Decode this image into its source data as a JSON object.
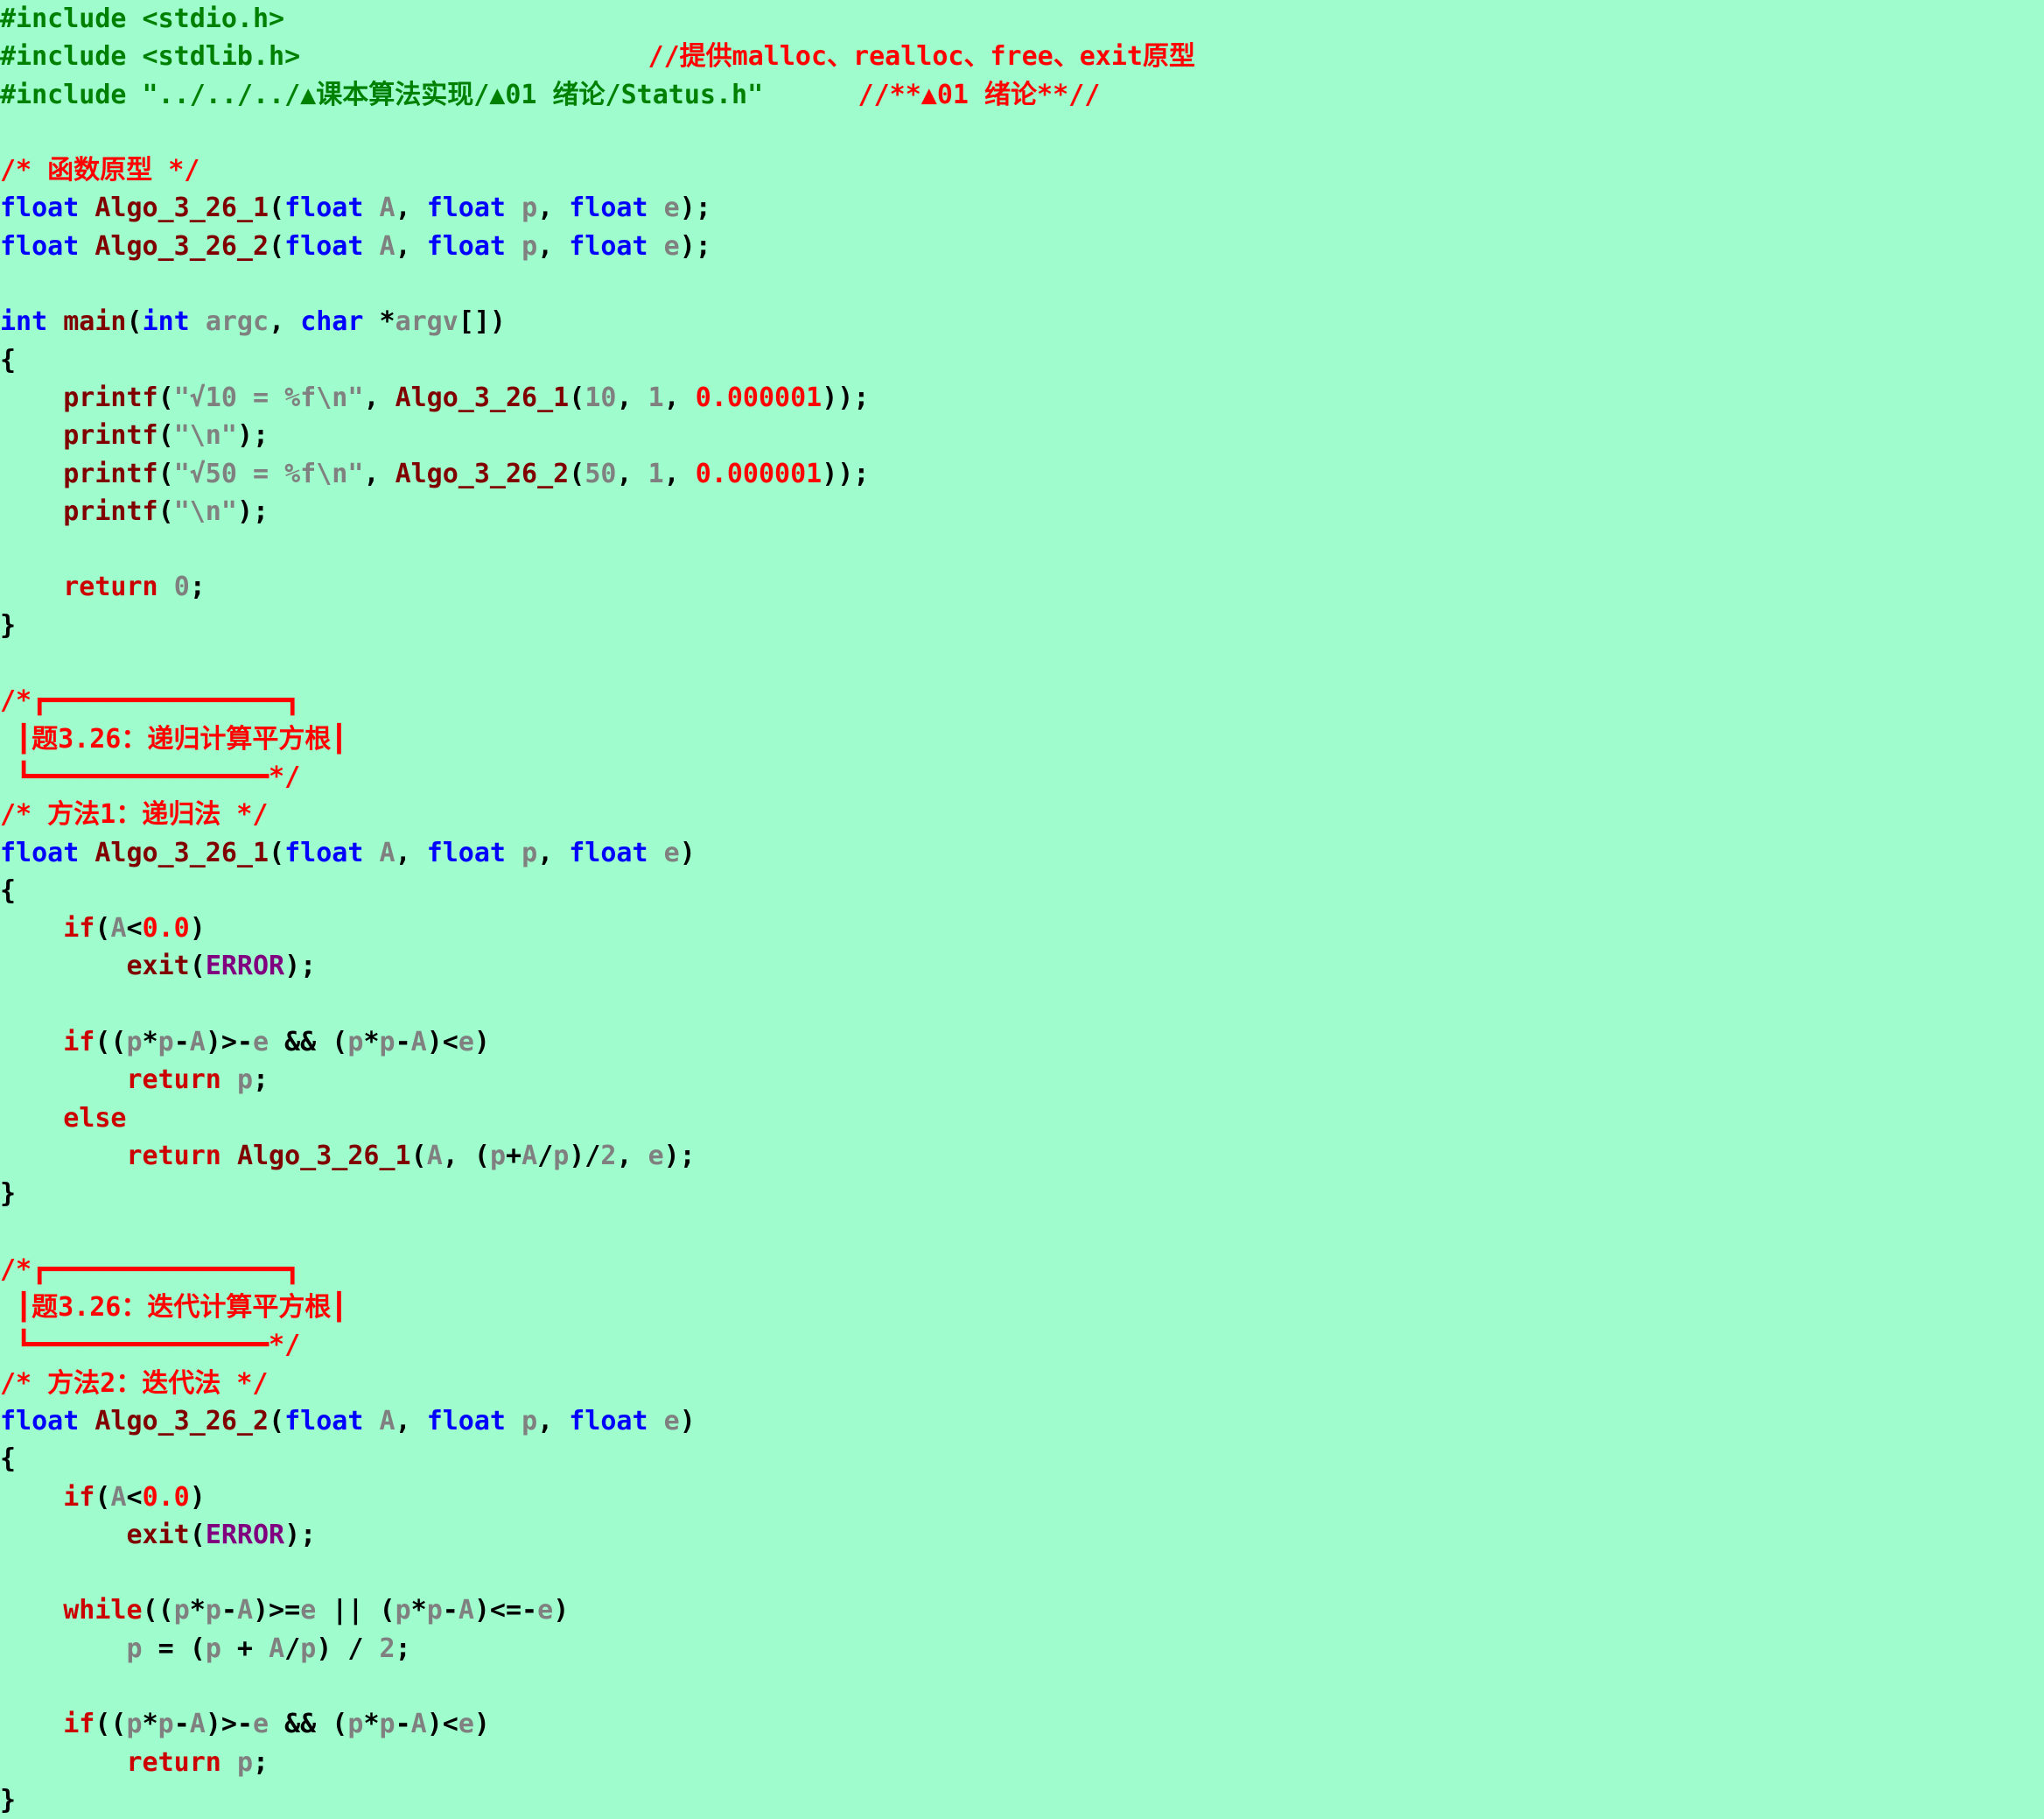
{
  "colors": {
    "background": "#9ffccc",
    "preprocessor": "#008000",
    "comment": "#ff0000",
    "keyword": "#0000ff",
    "control": "#cc0000",
    "function": "#800000",
    "identifier": "#808080",
    "number": "#ff0000",
    "macro": "#800080",
    "operator": "#000000"
  },
  "code_lines": [
    [
      {
        "t": "#include <stdio.h>",
        "c": "preprocessor"
      }
    ],
    [
      {
        "t": "#include <stdlib.h>",
        "c": "preprocessor"
      },
      {
        "t": "                      ",
        "c": "operator"
      },
      {
        "t": "//提供malloc、realloc、free、exit原型",
        "c": "comment"
      }
    ],
    [
      {
        "t": "#include \"../../../▲课本算法实现/▲01 绪论/Status.h\"",
        "c": "preprocessor"
      },
      {
        "t": "      ",
        "c": "operator"
      },
      {
        "t": "//**▲01 绪论**//",
        "c": "comment"
      }
    ],
    [],
    [
      {
        "t": "/* 函数原型 */",
        "c": "comment"
      }
    ],
    [
      {
        "t": "float",
        "c": "keyword"
      },
      {
        "t": " ",
        "c": "operator"
      },
      {
        "t": "Algo_3_26_1",
        "c": "function"
      },
      {
        "t": "(",
        "c": "operator"
      },
      {
        "t": "float",
        "c": "keyword"
      },
      {
        "t": " ",
        "c": "operator"
      },
      {
        "t": "A",
        "c": "identifier"
      },
      {
        "t": ", ",
        "c": "operator"
      },
      {
        "t": "float",
        "c": "keyword"
      },
      {
        "t": " ",
        "c": "operator"
      },
      {
        "t": "p",
        "c": "identifier"
      },
      {
        "t": ", ",
        "c": "operator"
      },
      {
        "t": "float",
        "c": "keyword"
      },
      {
        "t": " ",
        "c": "operator"
      },
      {
        "t": "e",
        "c": "identifier"
      },
      {
        "t": ");",
        "c": "operator"
      }
    ],
    [
      {
        "t": "float",
        "c": "keyword"
      },
      {
        "t": " ",
        "c": "operator"
      },
      {
        "t": "Algo_3_26_2",
        "c": "function"
      },
      {
        "t": "(",
        "c": "operator"
      },
      {
        "t": "float",
        "c": "keyword"
      },
      {
        "t": " ",
        "c": "operator"
      },
      {
        "t": "A",
        "c": "identifier"
      },
      {
        "t": ", ",
        "c": "operator"
      },
      {
        "t": "float",
        "c": "keyword"
      },
      {
        "t": " ",
        "c": "operator"
      },
      {
        "t": "p",
        "c": "identifier"
      },
      {
        "t": ", ",
        "c": "operator"
      },
      {
        "t": "float",
        "c": "keyword"
      },
      {
        "t": " ",
        "c": "operator"
      },
      {
        "t": "e",
        "c": "identifier"
      },
      {
        "t": ");",
        "c": "operator"
      }
    ],
    [],
    [
      {
        "t": "int",
        "c": "keyword"
      },
      {
        "t": " ",
        "c": "operator"
      },
      {
        "t": "main",
        "c": "function"
      },
      {
        "t": "(",
        "c": "operator"
      },
      {
        "t": "int",
        "c": "keyword"
      },
      {
        "t": " ",
        "c": "operator"
      },
      {
        "t": "argc",
        "c": "identifier"
      },
      {
        "t": ", ",
        "c": "operator"
      },
      {
        "t": "char",
        "c": "keyword"
      },
      {
        "t": " *",
        "c": "operator"
      },
      {
        "t": "argv",
        "c": "identifier"
      },
      {
        "t": "[])",
        "c": "operator"
      }
    ],
    [
      {
        "t": "{",
        "c": "operator"
      }
    ],
    [
      {
        "t": "    ",
        "c": "operator"
      },
      {
        "t": "printf",
        "c": "function"
      },
      {
        "t": "(",
        "c": "operator"
      },
      {
        "t": "\"√10 = %f\\n\"",
        "c": "identifier"
      },
      {
        "t": ", ",
        "c": "operator"
      },
      {
        "t": "Algo_3_26_1",
        "c": "function"
      },
      {
        "t": "(",
        "c": "operator"
      },
      {
        "t": "10",
        "c": "identifier"
      },
      {
        "t": ", ",
        "c": "operator"
      },
      {
        "t": "1",
        "c": "identifier"
      },
      {
        "t": ", ",
        "c": "operator"
      },
      {
        "t": "0.000001",
        "c": "number"
      },
      {
        "t": "));",
        "c": "operator"
      }
    ],
    [
      {
        "t": "    ",
        "c": "operator"
      },
      {
        "t": "printf",
        "c": "function"
      },
      {
        "t": "(",
        "c": "operator"
      },
      {
        "t": "\"\\n\"",
        "c": "identifier"
      },
      {
        "t": ");",
        "c": "operator"
      }
    ],
    [
      {
        "t": "    ",
        "c": "operator"
      },
      {
        "t": "printf",
        "c": "function"
      },
      {
        "t": "(",
        "c": "operator"
      },
      {
        "t": "\"√50 = %f\\n\"",
        "c": "identifier"
      },
      {
        "t": ", ",
        "c": "operator"
      },
      {
        "t": "Algo_3_26_2",
        "c": "function"
      },
      {
        "t": "(",
        "c": "operator"
      },
      {
        "t": "50",
        "c": "identifier"
      },
      {
        "t": ", ",
        "c": "operator"
      },
      {
        "t": "1",
        "c": "identifier"
      },
      {
        "t": ", ",
        "c": "operator"
      },
      {
        "t": "0.000001",
        "c": "number"
      },
      {
        "t": "));",
        "c": "operator"
      }
    ],
    [
      {
        "t": "    ",
        "c": "operator"
      },
      {
        "t": "printf",
        "c": "function"
      },
      {
        "t": "(",
        "c": "operator"
      },
      {
        "t": "\"\\n\"",
        "c": "identifier"
      },
      {
        "t": ");",
        "c": "operator"
      }
    ],
    [],
    [
      {
        "t": "    ",
        "c": "operator"
      },
      {
        "t": "return",
        "c": "control"
      },
      {
        "t": " ",
        "c": "operator"
      },
      {
        "t": "0",
        "c": "identifier"
      },
      {
        "t": ";",
        "c": "operator"
      }
    ],
    [
      {
        "t": "}",
        "c": "operator"
      }
    ],
    [],
    [
      {
        "t": "/*┏━━━━━━━━━━━━━━━┓",
        "c": "comment"
      }
    ],
    [
      {
        "t": " ┃题3.26：递归计算平方根┃",
        "c": "comment"
      }
    ],
    [
      {
        "t": " ┗━━━━━━━━━━━━━━━*/",
        "c": "comment"
      }
    ],
    [
      {
        "t": "/* 方法1：递归法 */",
        "c": "comment"
      }
    ],
    [
      {
        "t": "float",
        "c": "keyword"
      },
      {
        "t": " ",
        "c": "operator"
      },
      {
        "t": "Algo_3_26_1",
        "c": "function"
      },
      {
        "t": "(",
        "c": "operator"
      },
      {
        "t": "float",
        "c": "keyword"
      },
      {
        "t": " ",
        "c": "operator"
      },
      {
        "t": "A",
        "c": "identifier"
      },
      {
        "t": ", ",
        "c": "operator"
      },
      {
        "t": "float",
        "c": "keyword"
      },
      {
        "t": " ",
        "c": "operator"
      },
      {
        "t": "p",
        "c": "identifier"
      },
      {
        "t": ", ",
        "c": "operator"
      },
      {
        "t": "float",
        "c": "keyword"
      },
      {
        "t": " ",
        "c": "operator"
      },
      {
        "t": "e",
        "c": "identifier"
      },
      {
        "t": ")",
        "c": "operator"
      }
    ],
    [
      {
        "t": "{",
        "c": "operator"
      }
    ],
    [
      {
        "t": "    ",
        "c": "operator"
      },
      {
        "t": "if",
        "c": "control"
      },
      {
        "t": "(",
        "c": "operator"
      },
      {
        "t": "A",
        "c": "identifier"
      },
      {
        "t": "<",
        "c": "operator"
      },
      {
        "t": "0.0",
        "c": "number"
      },
      {
        "t": ")",
        "c": "operator"
      }
    ],
    [
      {
        "t": "        ",
        "c": "operator"
      },
      {
        "t": "exit",
        "c": "function"
      },
      {
        "t": "(",
        "c": "operator"
      },
      {
        "t": "ERROR",
        "c": "macro"
      },
      {
        "t": ");",
        "c": "operator"
      }
    ],
    [],
    [
      {
        "t": "    ",
        "c": "operator"
      },
      {
        "t": "if",
        "c": "control"
      },
      {
        "t": "((",
        "c": "operator"
      },
      {
        "t": "p",
        "c": "identifier"
      },
      {
        "t": "*",
        "c": "operator"
      },
      {
        "t": "p",
        "c": "identifier"
      },
      {
        "t": "-",
        "c": "operator"
      },
      {
        "t": "A",
        "c": "identifier"
      },
      {
        "t": ")>-",
        "c": "operator"
      },
      {
        "t": "e",
        "c": "identifier"
      },
      {
        "t": " && (",
        "c": "operator"
      },
      {
        "t": "p",
        "c": "identifier"
      },
      {
        "t": "*",
        "c": "operator"
      },
      {
        "t": "p",
        "c": "identifier"
      },
      {
        "t": "-",
        "c": "operator"
      },
      {
        "t": "A",
        "c": "identifier"
      },
      {
        "t": ")<",
        "c": "operator"
      },
      {
        "t": "e",
        "c": "identifier"
      },
      {
        "t": ")",
        "c": "operator"
      }
    ],
    [
      {
        "t": "        ",
        "c": "operator"
      },
      {
        "t": "return",
        "c": "control"
      },
      {
        "t": " ",
        "c": "operator"
      },
      {
        "t": "p",
        "c": "identifier"
      },
      {
        "t": ";",
        "c": "operator"
      }
    ],
    [
      {
        "t": "    ",
        "c": "operator"
      },
      {
        "t": "else",
        "c": "control"
      }
    ],
    [
      {
        "t": "        ",
        "c": "operator"
      },
      {
        "t": "return",
        "c": "control"
      },
      {
        "t": " ",
        "c": "operator"
      },
      {
        "t": "Algo_3_26_1",
        "c": "function"
      },
      {
        "t": "(",
        "c": "operator"
      },
      {
        "t": "A",
        "c": "identifier"
      },
      {
        "t": ", (",
        "c": "operator"
      },
      {
        "t": "p",
        "c": "identifier"
      },
      {
        "t": "+",
        "c": "operator"
      },
      {
        "t": "A",
        "c": "identifier"
      },
      {
        "t": "/",
        "c": "operator"
      },
      {
        "t": "p",
        "c": "identifier"
      },
      {
        "t": ")/",
        "c": "operator"
      },
      {
        "t": "2",
        "c": "identifier"
      },
      {
        "t": ", ",
        "c": "operator"
      },
      {
        "t": "e",
        "c": "identifier"
      },
      {
        "t": ");",
        "c": "operator"
      }
    ],
    [
      {
        "t": "}",
        "c": "operator"
      }
    ],
    [],
    [
      {
        "t": "/*┏━━━━━━━━━━━━━━━┓",
        "c": "comment"
      }
    ],
    [
      {
        "t": " ┃题3.26：迭代计算平方根┃",
        "c": "comment"
      }
    ],
    [
      {
        "t": " ┗━━━━━━━━━━━━━━━*/",
        "c": "comment"
      }
    ],
    [
      {
        "t": "/* 方法2：迭代法 */",
        "c": "comment"
      }
    ],
    [
      {
        "t": "float",
        "c": "keyword"
      },
      {
        "t": " ",
        "c": "operator"
      },
      {
        "t": "Algo_3_26_2",
        "c": "function"
      },
      {
        "t": "(",
        "c": "operator"
      },
      {
        "t": "float",
        "c": "keyword"
      },
      {
        "t": " ",
        "c": "operator"
      },
      {
        "t": "A",
        "c": "identifier"
      },
      {
        "t": ", ",
        "c": "operator"
      },
      {
        "t": "float",
        "c": "keyword"
      },
      {
        "t": " ",
        "c": "operator"
      },
      {
        "t": "p",
        "c": "identifier"
      },
      {
        "t": ", ",
        "c": "operator"
      },
      {
        "t": "float",
        "c": "keyword"
      },
      {
        "t": " ",
        "c": "operator"
      },
      {
        "t": "e",
        "c": "identifier"
      },
      {
        "t": ")",
        "c": "operator"
      }
    ],
    [
      {
        "t": "{",
        "c": "operator"
      }
    ],
    [
      {
        "t": "    ",
        "c": "operator"
      },
      {
        "t": "if",
        "c": "control"
      },
      {
        "t": "(",
        "c": "operator"
      },
      {
        "t": "A",
        "c": "identifier"
      },
      {
        "t": "<",
        "c": "operator"
      },
      {
        "t": "0.0",
        "c": "number"
      },
      {
        "t": ")",
        "c": "operator"
      }
    ],
    [
      {
        "t": "        ",
        "c": "operator"
      },
      {
        "t": "exit",
        "c": "function"
      },
      {
        "t": "(",
        "c": "operator"
      },
      {
        "t": "ERROR",
        "c": "macro"
      },
      {
        "t": ");",
        "c": "operator"
      }
    ],
    [],
    [
      {
        "t": "    ",
        "c": "operator"
      },
      {
        "t": "while",
        "c": "control"
      },
      {
        "t": "((",
        "c": "operator"
      },
      {
        "t": "p",
        "c": "identifier"
      },
      {
        "t": "*",
        "c": "operator"
      },
      {
        "t": "p",
        "c": "identifier"
      },
      {
        "t": "-",
        "c": "operator"
      },
      {
        "t": "A",
        "c": "identifier"
      },
      {
        "t": ")>=",
        "c": "operator"
      },
      {
        "t": "e",
        "c": "identifier"
      },
      {
        "t": " || (",
        "c": "operator"
      },
      {
        "t": "p",
        "c": "identifier"
      },
      {
        "t": "*",
        "c": "operator"
      },
      {
        "t": "p",
        "c": "identifier"
      },
      {
        "t": "-",
        "c": "operator"
      },
      {
        "t": "A",
        "c": "identifier"
      },
      {
        "t": ")<=-",
        "c": "operator"
      },
      {
        "t": "e",
        "c": "identifier"
      },
      {
        "t": ")",
        "c": "operator"
      }
    ],
    [
      {
        "t": "        ",
        "c": "operator"
      },
      {
        "t": "p",
        "c": "identifier"
      },
      {
        "t": " = (",
        "c": "operator"
      },
      {
        "t": "p",
        "c": "identifier"
      },
      {
        "t": " + ",
        "c": "operator"
      },
      {
        "t": "A",
        "c": "identifier"
      },
      {
        "t": "/",
        "c": "operator"
      },
      {
        "t": "p",
        "c": "identifier"
      },
      {
        "t": ") / ",
        "c": "operator"
      },
      {
        "t": "2",
        "c": "identifier"
      },
      {
        "t": ";",
        "c": "operator"
      }
    ],
    [],
    [
      {
        "t": "    ",
        "c": "operator"
      },
      {
        "t": "if",
        "c": "control"
      },
      {
        "t": "((",
        "c": "operator"
      },
      {
        "t": "p",
        "c": "identifier"
      },
      {
        "t": "*",
        "c": "operator"
      },
      {
        "t": "p",
        "c": "identifier"
      },
      {
        "t": "-",
        "c": "operator"
      },
      {
        "t": "A",
        "c": "identifier"
      },
      {
        "t": ")>-",
        "c": "operator"
      },
      {
        "t": "e",
        "c": "identifier"
      },
      {
        "t": " && (",
        "c": "operator"
      },
      {
        "t": "p",
        "c": "identifier"
      },
      {
        "t": "*",
        "c": "operator"
      },
      {
        "t": "p",
        "c": "identifier"
      },
      {
        "t": "-",
        "c": "operator"
      },
      {
        "t": "A",
        "c": "identifier"
      },
      {
        "t": ")<",
        "c": "operator"
      },
      {
        "t": "e",
        "c": "identifier"
      },
      {
        "t": ")",
        "c": "operator"
      }
    ],
    [
      {
        "t": "        ",
        "c": "operator"
      },
      {
        "t": "return",
        "c": "control"
      },
      {
        "t": " ",
        "c": "operator"
      },
      {
        "t": "p",
        "c": "identifier"
      },
      {
        "t": ";",
        "c": "operator"
      }
    ],
    [
      {
        "t": "}",
        "c": "operator"
      }
    ]
  ]
}
